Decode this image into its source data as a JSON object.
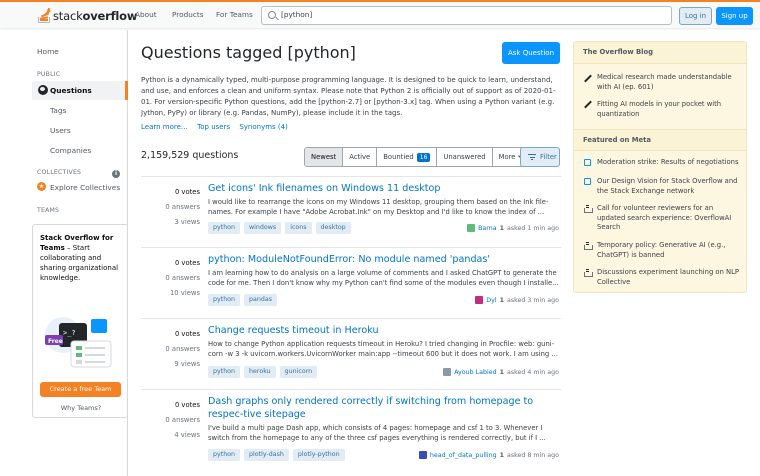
{
  "header": {
    "logo_light": "stack",
    "logo_bold": "overflow",
    "nav": [
      "About",
      "Products",
      "For Teams"
    ],
    "search_value": "[python]",
    "login": "Log in",
    "signup": "Sign up"
  },
  "sidebar": {
    "home": "Home",
    "public": "PUBLIC",
    "questions": "Questions",
    "tags": "Tags",
    "users": "Users",
    "companies": "Companies",
    "collectives": "COLLECTIVES",
    "explore": "Explore Collectives",
    "teams_section": "TEAMS",
    "teams_title_bold": "Stack Overflow for Teams",
    "teams_title_rest": " – Start collaborating and sharing organizational knowledge.",
    "teams_button": "Create a free Team",
    "why_teams": "Why Teams?",
    "free_label": "Free"
  },
  "main": {
    "title": "Questions tagged [python]",
    "ask_button": "Ask Question",
    "description": "Python is a dynamically typed, multi-purpose programming language. It is designed to be quick to learn, understand, and use, and enforces a clean and uniform syntax. Please note that Python 2 is officially out of support as of 2020-01-01. For version-specific Python questions, add the [python-2.7] or [python-3.x] tag. When using a Python variant (e.g. Jython, PyPy) or library (e.g. Pandas, NumPy), please include it in the tags.",
    "links": [
      "Learn more…",
      "Top users",
      "Synonyms (4)"
    ],
    "count": "2,159,529 questions",
    "filters": {
      "newest": "Newest",
      "active": "Active",
      "bountied": "Bountied",
      "bountied_count": "16",
      "unanswered": "Unanswered",
      "more": "More",
      "filter": "Filter"
    }
  },
  "questions": [
    {
      "votes": "0 votes",
      "answers": "0 answers",
      "views": "3 views",
      "title": "Get icons' Ink filenames on Windows 11 desktop",
      "excerpt": "I would like to rearrange the icons on my Windows 11 desktop, grouping them based on the Ink file-names. For example I have \"Adobe Acrobat.Ink\" on my Desktop and I'd like to know the index of ...",
      "tags": [
        "python",
        "windows",
        "icons",
        "desktop"
      ],
      "user": "Barna",
      "rep": "1",
      "time": "asked 1 min ago",
      "avatar_color": "#5eba7d"
    },
    {
      "votes": "0 votes",
      "answers": "0 answers",
      "views": "10 views",
      "title": "python: ModuleNotFoundError: No module named 'pandas'",
      "excerpt": "I am learning how to do analysis on a large volume of comments and I asked ChatGPT to generate the code for me. Then I don't know why my Python can't find some of the modules even though I installe...",
      "tags": [
        "python",
        "pandas"
      ],
      "user": "Dyl",
      "rep": "1",
      "time": "asked 3 min ago",
      "avatar_color": "#c22e7a"
    },
    {
      "votes": "0 votes",
      "answers": "0 answers",
      "views": "9 views",
      "title": "Change requests timeout in Heroku",
      "excerpt": "How to change Python application requests timeout in Heroku? I tried changing in Procfile: web: guni-corn -w 3 -k uvicorn.workers.UvicornWorker main:app --timeout 600 but it does not work. I am using ...",
      "tags": [
        "python",
        "heroku",
        "gunicorn"
      ],
      "user": "Ayoub Labied",
      "rep": "1",
      "time": "asked 4 min ago",
      "avatar_color": "#8a9aa8"
    },
    {
      "votes": "0 votes",
      "answers": "0 answers",
      "views": "4 views",
      "title": "Dash graphs only rendered correctly if switching from homepage to respec-tive sitepage",
      "excerpt": "I've build a multi page Dash app, which consists of 4 pages: homepage and csf 1 to 3. Whenever I switch from the homepage to any of the three csf pages everything is rendered correctly, but if I ...",
      "tags": [
        "python",
        "plotly-dash",
        "plotly-python"
      ],
      "user": "head_of_data_pulling",
      "rep": "1",
      "time": "asked 8 min ago",
      "avatar_color": "#3a4cb8"
    }
  ],
  "right": {
    "blog_title": "The Overflow Blog",
    "blog_items": [
      "Medical research made understandable with AI (ep. 601)",
      "Fitting AI models in your pocket with quantization"
    ],
    "meta_title": "Featured on Meta",
    "meta_items": [
      "Moderation strike: Results of negotiations",
      "Our Design Vision for Stack Overflow and the Stack Exchange network",
      "Call for volunteer reviewers for an updated search experience: OverflowAI Search",
      "Temporary policy: Generative AI (e.g., ChatGPT) is banned",
      "Discussions experiment launching on NLP Collective"
    ]
  },
  "colors": {
    "accent": "#f48225",
    "link": "#0074cc",
    "primary_button": "#0a95ff",
    "tag_bg": "#e1ecf4",
    "sidebar_yellow": "#fdf7e2"
  }
}
